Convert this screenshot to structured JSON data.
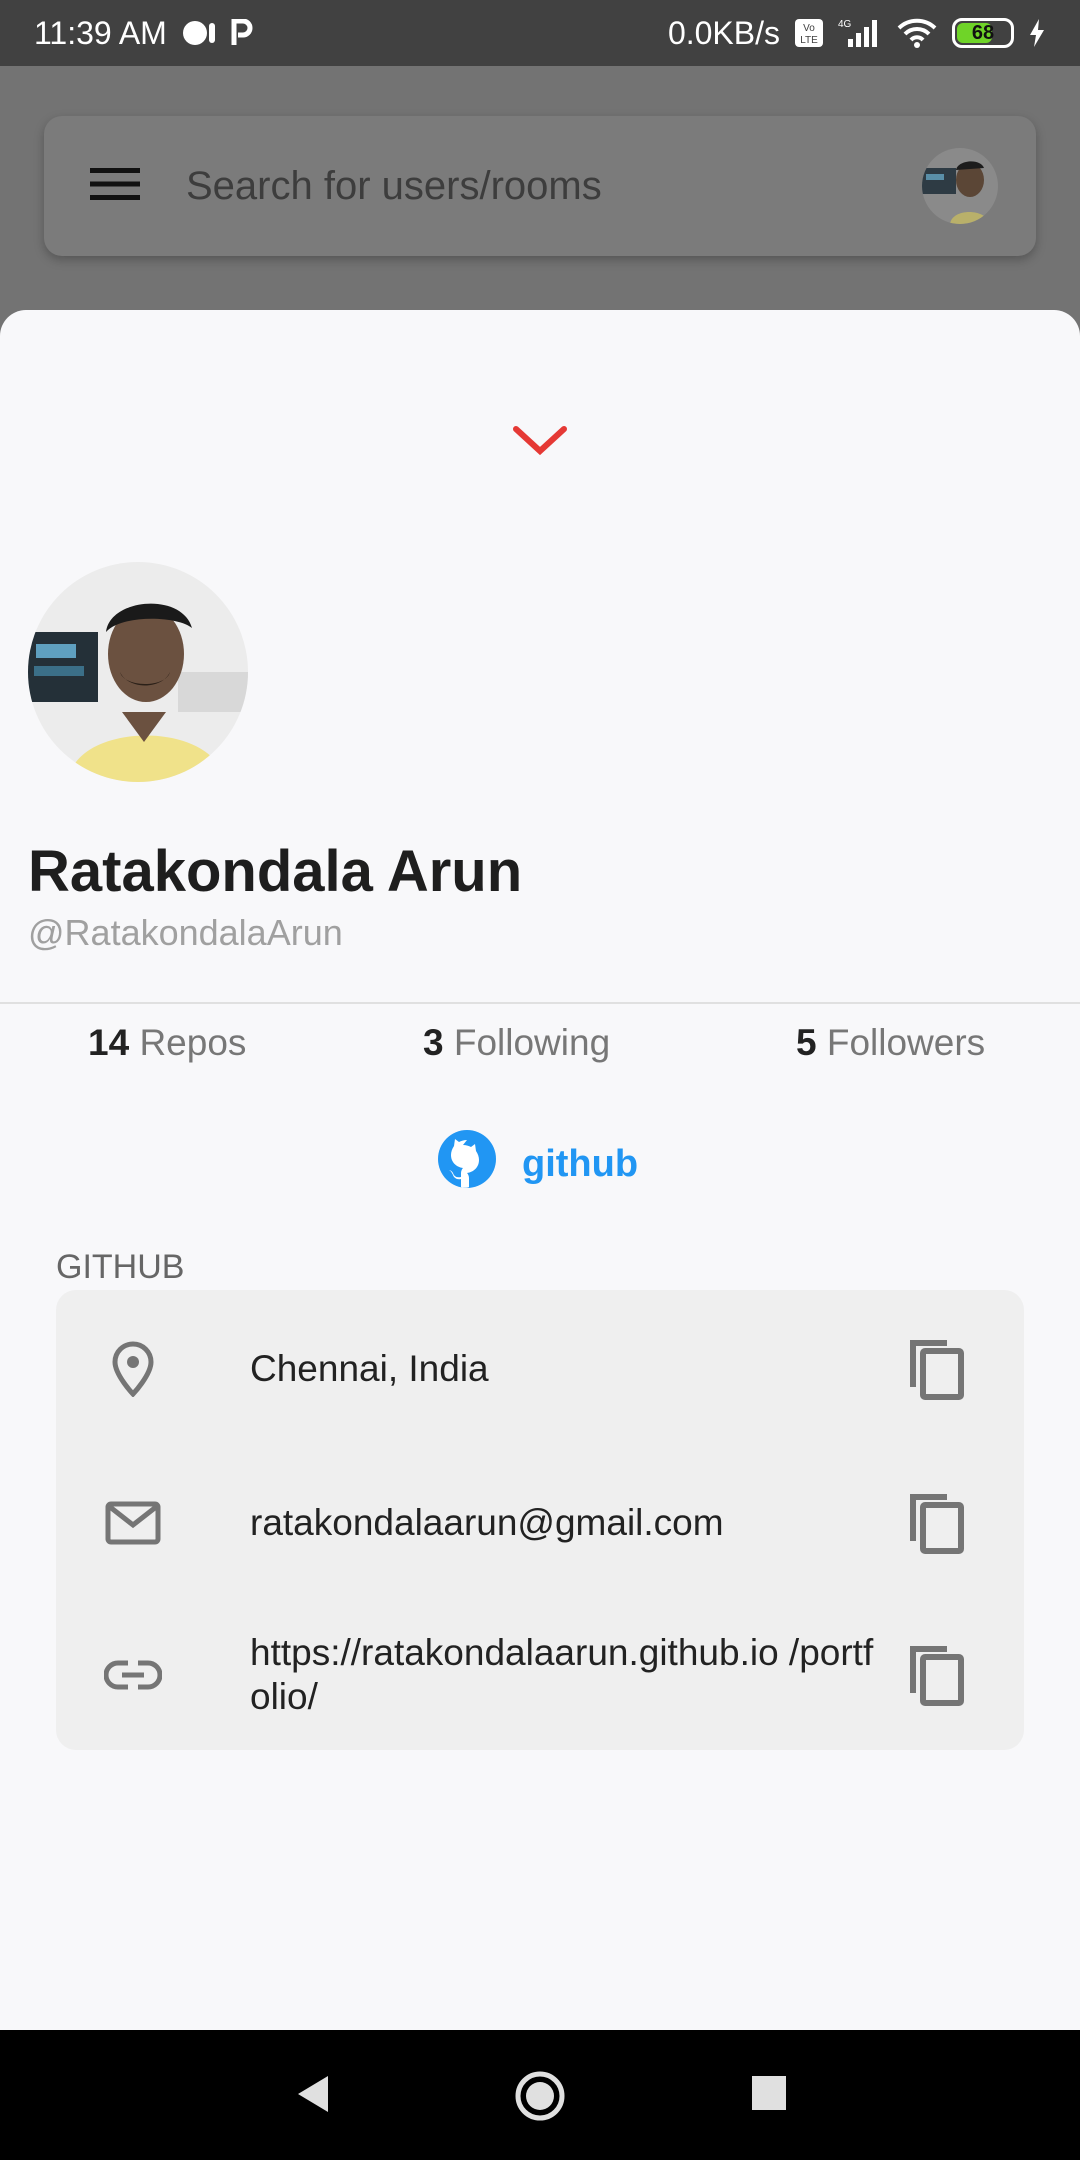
{
  "status_bar": {
    "time": "11:39 AM",
    "net_speed": "0.0KB/s",
    "network": "4G",
    "volte": "Vo LTE",
    "battery": "68",
    "battery_level": 0.68
  },
  "search": {
    "placeholder": "Search for users/rooms",
    "menu_icon": "hamburger-menu-icon"
  },
  "profile": {
    "name": "Ratakondala Arun",
    "handle": "@RatakondalaArun",
    "stats": [
      {
        "count": "14",
        "label": "Repos"
      },
      {
        "count": "3",
        "label": "Following"
      },
      {
        "count": "5",
        "label": "Followers"
      }
    ],
    "link_label": "github"
  },
  "details": {
    "section_title": "GITHUB",
    "rows": [
      {
        "icon": "location-pin-icon",
        "text": "Chennai, India"
      },
      {
        "icon": "email-icon",
        "text": "ratakondalaarun@gmail.com"
      },
      {
        "icon": "link-icon",
        "text": "https://ratakondalaarun.github.io /portfolio/"
      }
    ]
  },
  "colors": {
    "accent_red": "#e53935",
    "link_blue": "#2196f3",
    "icon_gray": "#757575"
  }
}
